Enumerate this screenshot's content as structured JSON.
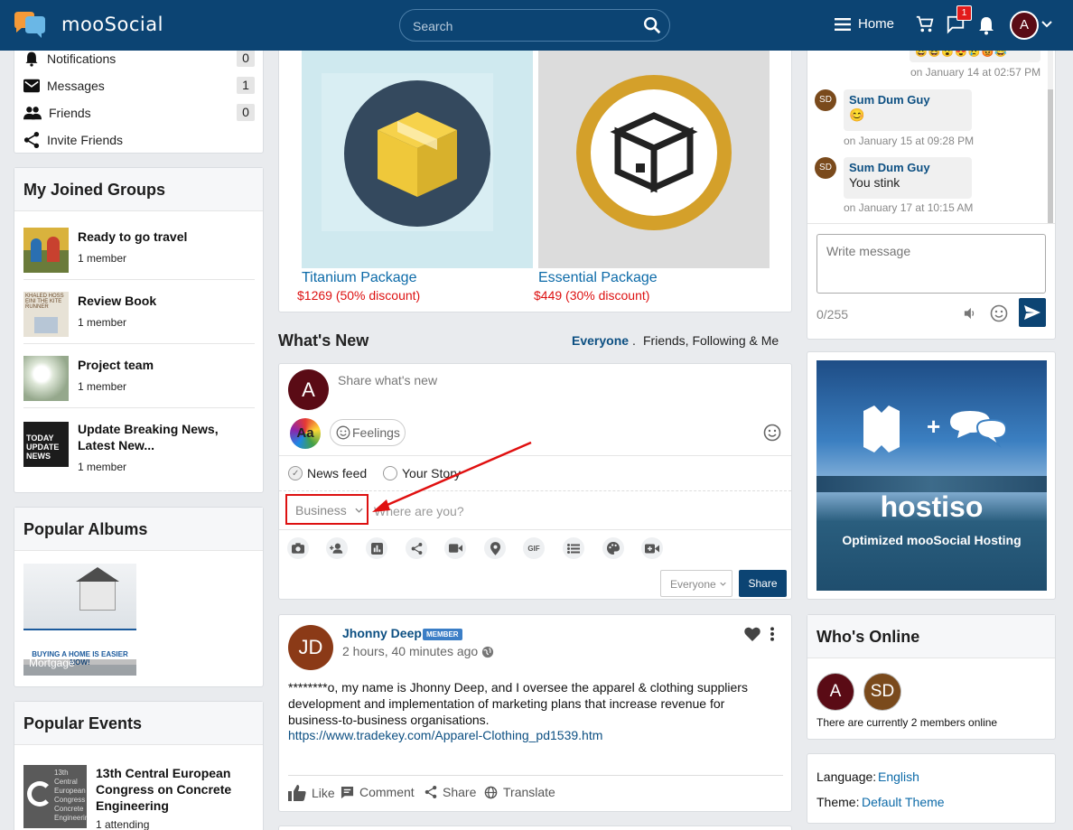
{
  "header": {
    "app_name": "mooSocial",
    "search_placeholder": "Search",
    "home_label": "Home",
    "message_badge": "1",
    "user_initial": "A"
  },
  "left_menu": [
    {
      "label": "Notifications",
      "count": "0"
    },
    {
      "label": "Messages",
      "count": "1"
    },
    {
      "label": "Friends",
      "count": "0"
    },
    {
      "label": "Invite Friends",
      "count": ""
    }
  ],
  "groups": {
    "title": "My Joined Groups",
    "items": [
      {
        "name": "Ready to go travel",
        "members": "1 member"
      },
      {
        "name": "Review Book",
        "members": "1 member",
        "thumb_text": "KHALED HOSSEINI THE KITE RUNNER"
      },
      {
        "name": "Project team",
        "members": "1 member"
      },
      {
        "name": "Update Breaking News, Latest New...",
        "members": "1 member",
        "thumb_text": "TODAY UPDATE NEWS"
      }
    ]
  },
  "albums": {
    "title": "Popular Albums",
    "items": [
      {
        "name": "Mortgage",
        "banner": "BUYING A HOME IS EASIER NOW!"
      }
    ]
  },
  "events": {
    "title": "Popular Events",
    "items": [
      {
        "name": "13th Central European Congress on Concrete Engineering",
        "attending": "1 attending",
        "thumb_text": "13th Central European Congress Concrete Engineering"
      }
    ]
  },
  "packages": [
    {
      "name": "Titanium Package",
      "price": "$1269 (50% discount)"
    },
    {
      "name": "Essential Package",
      "price": "$449 (30% discount)"
    }
  ],
  "whats_new": {
    "title": "What's New",
    "filter_active": "Everyone",
    "filter_sep": ".",
    "filter_other": "Friends, Following & Me"
  },
  "composer": {
    "avatar": "A",
    "placeholder": "Share what's new",
    "style_label": "Aa",
    "feelings": "Feelings",
    "option_feed": "News feed",
    "option_story": "Your Story",
    "category": "Business",
    "location_placeholder": "Where are you?",
    "privacy": "Everyone",
    "share": "Share"
  },
  "post": {
    "author": "Jhonny Deep",
    "badge": "MEMBER",
    "avatar": "JD",
    "time": "2 hours, 40 minutes ago",
    "text": "********o, my name is Jhonny Deep, and I oversee the apparel & clothing suppliers development and implementation of marketing plans that increase revenue for business-to-business organisations.",
    "link": "https://www.tradekey.com/Apparel-Clothing_pd1539.htm",
    "actions": {
      "like": "Like",
      "comment": "Comment",
      "share": "Share",
      "translate": "Translate"
    }
  },
  "chat": {
    "first_time": "on January 14 at 02:57 PM",
    "messages": [
      {
        "name": "Sum Dum Guy",
        "avatar": "SD",
        "text": "😊",
        "time": "on January 15 at 09:28 PM"
      },
      {
        "name": "Sum Dum Guy",
        "avatar": "SD",
        "text": "You stink",
        "time": "on January 17 at 10:15 AM"
      }
    ],
    "placeholder": "Write message",
    "counter": "0/255"
  },
  "ad": {
    "brand": "hostiso",
    "tagline": "Optimized mooSocial Hosting"
  },
  "online": {
    "title": "Who's Online",
    "users": [
      "A",
      "SD"
    ],
    "status": "There are currently 2 members online"
  },
  "settings": {
    "language_label": "Language:",
    "language": "English",
    "theme_label": "Theme:",
    "theme": "Default Theme"
  },
  "colors": {
    "header": "#0c4473",
    "accent": "#0c4f82",
    "price": "#dd1111",
    "highlight": "#dd1111"
  }
}
